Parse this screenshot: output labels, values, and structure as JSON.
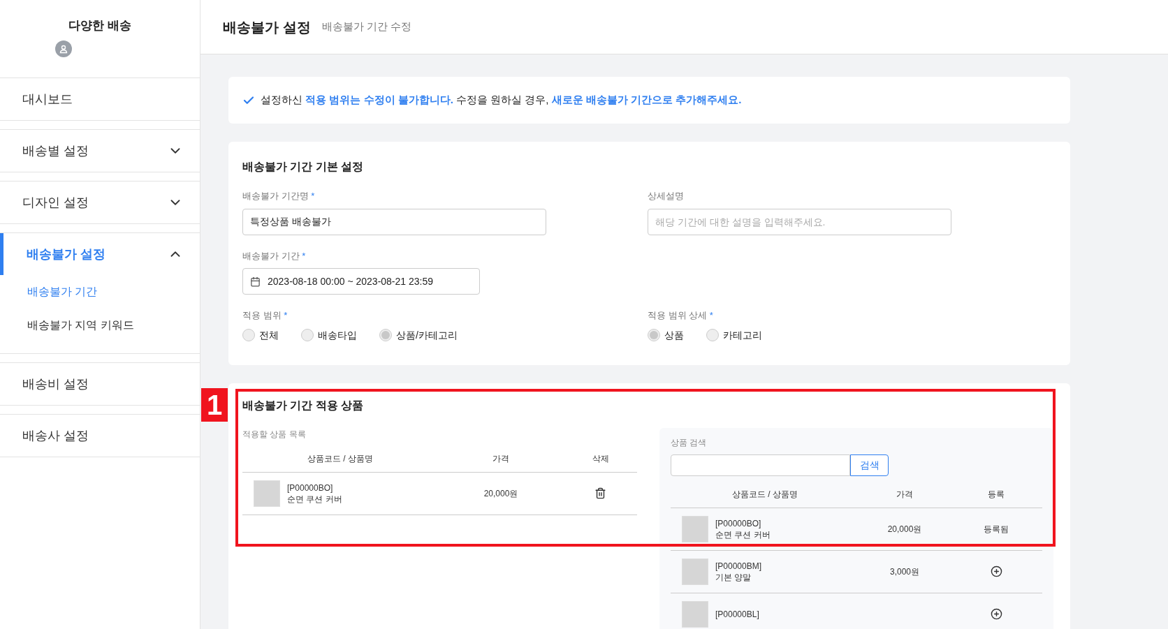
{
  "sidebar": {
    "brand": "다양한 배송",
    "items": [
      {
        "kind": "link",
        "label": "대시보드",
        "selected": false
      },
      {
        "kind": "group",
        "label": "배송별 설정",
        "selected": false,
        "expanded": false
      },
      {
        "kind": "group",
        "label": "디자인 설정",
        "selected": false,
        "expanded": false
      },
      {
        "kind": "group",
        "label": "배송불가 설정",
        "selected": true,
        "expanded": true,
        "children": [
          {
            "label": "배송불가 기간",
            "selected": true
          },
          {
            "label": "배송불가 지역 키워드",
            "selected": false
          }
        ]
      },
      {
        "kind": "link",
        "label": "배송비 설정",
        "selected": false
      },
      {
        "kind": "link",
        "label": "배송사 설정",
        "selected": false
      }
    ]
  },
  "header": {
    "title": "배송불가 설정",
    "subtitle": "배송불가 기간 수정"
  },
  "notice": "설정하신 **적용 범위는 수정이 불가합니다.** 수정을 원하실 경우, **새로운 배송불가 기간으로 추가해주세요.**",
  "basic": {
    "title": "배송불가 기간 기본 설정",
    "name_field": {
      "label": "배송불가 기간명",
      "required_mark": "*",
      "value": "특정상품 배송불가"
    },
    "desc_field": {
      "label": "상세설명",
      "placeholder": "해당 기간에 대한 설명을 입력해주세요."
    },
    "period_field": {
      "label": "배송불가 기간",
      "required_mark": "*",
      "value": "2023-08-18 00:00 ~ 2023-08-21 23:59"
    },
    "scope": {
      "label": "적용 범위",
      "required_mark": "*",
      "options": [
        {
          "label": "전체",
          "selected": false
        },
        {
          "label": "배송타입",
          "selected": false
        },
        {
          "label": "상품/카테고리",
          "selected": true
        }
      ]
    },
    "scope_detail": {
      "label": "적용 범위 상세",
      "required_mark": "*",
      "options": [
        {
          "label": "상품",
          "selected": true
        },
        {
          "label": "카테고리",
          "selected": false
        }
      ]
    }
  },
  "products": {
    "title": "배송불가 기간 적용 상품",
    "callout": "1",
    "list": {
      "label": "적용할 상품 목록",
      "columns": [
        "상품코드 / 상품명",
        "가격",
        "삭제"
      ],
      "rows": [
        {
          "code": "[P00000BO]",
          "name": "순면 쿠션 커버",
          "price": "20,000원"
        }
      ]
    },
    "search": {
      "label": "상품 검색",
      "button": "검색",
      "columns": [
        "상품코드 / 상품명",
        "가격",
        "등록"
      ],
      "rows": [
        {
          "kind": "registered",
          "code": "[P00000BO]",
          "name": "순면 쿠션 커버",
          "price": "20,000원",
          "status_text": "등록됨"
        },
        {
          "kind": "add",
          "code": "[P00000BM]",
          "name": "기본 양말",
          "price": "3,000원"
        },
        {
          "kind": "add",
          "code": "[P00000BL]"
        }
      ]
    }
  }
}
